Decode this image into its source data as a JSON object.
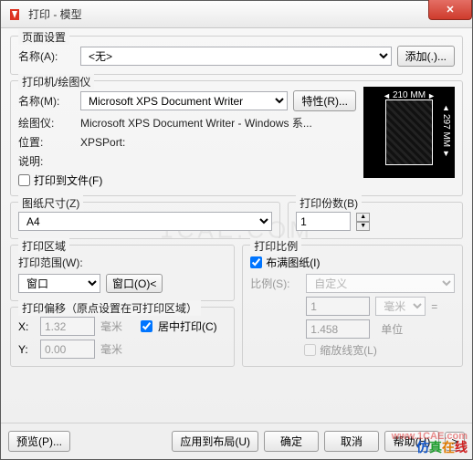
{
  "title": "打印 - 模型",
  "watermark": "1CAE.COM",
  "overlay_brand": [
    "仿",
    "真",
    "在",
    "线"
  ],
  "overlay_url": "www.1CAE.com",
  "page_setup": {
    "legend": "页面设置",
    "name_label": "名称(A):",
    "name_value": "<无>",
    "add_btn": "添加(.)..."
  },
  "printer": {
    "legend": "打印机/绘图仪",
    "name_label": "名称(M):",
    "name_value": "Microsoft XPS Document Writer",
    "props_btn": "特性(R)...",
    "plotter_label": "绘图仪:",
    "plotter_value": "Microsoft XPS Document Writer - Windows 系...",
    "location_label": "位置:",
    "location_value": "XPSPort:",
    "desc_label": "说明:",
    "desc_value": "",
    "to_file_label": "打印到文件(F)",
    "preview": {
      "width_label": "210 MM",
      "height_label": "297 MM"
    }
  },
  "paper": {
    "legend": "图纸尺寸(Z)",
    "value": "A4"
  },
  "copies": {
    "legend": "打印份数(B)",
    "value": "1"
  },
  "area": {
    "legend": "打印区域",
    "range_label": "打印范围(W):",
    "range_value": "窗口",
    "window_btn": "窗口(O)<"
  },
  "scale": {
    "legend": "打印比例",
    "fit_label": "布满图纸(I)",
    "scale_label": "比例(S):",
    "scale_value": "自定义",
    "a_value": "1",
    "a_unit": "毫米",
    "eq": "=",
    "b_value": "1.458",
    "b_unit": "单位",
    "lw_label": "缩放线宽(L)"
  },
  "offset": {
    "legend": "打印偏移（原点设置在可打印区域）",
    "x_label": "X:",
    "x_value": "1.32",
    "x_unit": "毫米",
    "y_label": "Y:",
    "y_value": "0.00",
    "y_unit": "毫米",
    "center_label": "居中打印(C)"
  },
  "buttons": {
    "preview": "预览(P)...",
    "apply": "应用到布局(U)",
    "ok": "确定",
    "cancel": "取消",
    "help": "帮助(H)",
    "more": ">"
  }
}
